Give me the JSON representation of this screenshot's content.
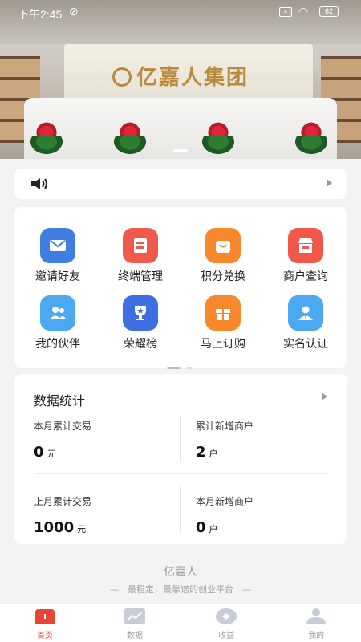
{
  "status_bar": {
    "time": "下午2:45",
    "battery": "62"
  },
  "banner": {
    "company_name": "亿嘉人集团"
  },
  "notice": {
    "text": ""
  },
  "menu": {
    "items": [
      {
        "label": "邀请好友",
        "icon": "mail-icon",
        "color": "#3f7de0"
      },
      {
        "label": "终端管理",
        "icon": "terminal-icon",
        "color": "#ef5a4c"
      },
      {
        "label": "积分兑换",
        "icon": "shopping-bag-icon",
        "color": "#f7882b"
      },
      {
        "label": "商户查询",
        "icon": "store-icon",
        "color": "#f2584a"
      },
      {
        "label": "我的伙伴",
        "icon": "partners-icon",
        "color": "#4aa9f0"
      },
      {
        "label": "荣耀榜",
        "icon": "trophy-icon",
        "color": "#3e6fe0"
      },
      {
        "label": "马上订购",
        "icon": "gift-icon",
        "color": "#f7882b"
      },
      {
        "label": "实名认证",
        "icon": "user-verify-icon",
        "color": "#4aa9f0"
      }
    ]
  },
  "stats": {
    "title": "数据统计",
    "items": [
      {
        "label": "本月累计交易",
        "value": "0",
        "unit": "元"
      },
      {
        "label": "累计新增商户",
        "value": "2",
        "unit": "户"
      },
      {
        "label": "上月累计交易",
        "value": "1000",
        "unit": "元"
      },
      {
        "label": "本月新增商户",
        "value": "0",
        "unit": "户"
      }
    ]
  },
  "footer": {
    "brand": "亿嘉人",
    "slogan": "—　最稳定，最靠谱的创业平台　—"
  },
  "tabs": [
    {
      "label": "首页",
      "icon": "home-icon",
      "active": true
    },
    {
      "label": "数据",
      "icon": "chart-icon",
      "active": false
    },
    {
      "label": "收益",
      "icon": "earnings-icon",
      "active": false
    },
    {
      "label": "我的",
      "icon": "profile-icon",
      "active": false
    }
  ],
  "colors": {
    "accent": "#e94335",
    "inactive": "#c8ccd6"
  }
}
